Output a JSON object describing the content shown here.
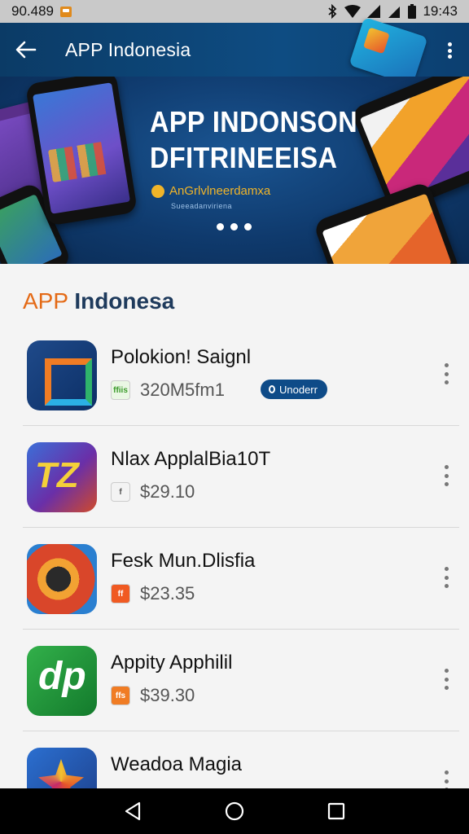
{
  "status_bar": {
    "left_text": "90.489",
    "time": "19:43"
  },
  "app_bar": {
    "title": "APP Indonesia"
  },
  "banner": {
    "title_line1": "APP INDONSON",
    "title_line2": "DFITRINEEISA",
    "subtitle": "AnGrlvlneerdamxa",
    "subtitle_small": "Sueeadanviriena",
    "dots": 3
  },
  "section": {
    "title_accent": "APP",
    "title_main": "Indonesa"
  },
  "apps": [
    {
      "name": "Polokion! Saignl",
      "badge": "ffiis",
      "price": "320M5fm1",
      "pill": "Unoderr"
    },
    {
      "name": "Nlax ApplalBia10T",
      "badge": "f",
      "price": "$29.10"
    },
    {
      "name": "Fesk Mun.Dlisfia",
      "badge": "ff",
      "price": "$23.35"
    },
    {
      "name": "Appity Apphilil",
      "badge": "ffs",
      "price": "$39.30"
    },
    {
      "name": "Weadoa Magia",
      "badge": "",
      "price": ""
    }
  ]
}
